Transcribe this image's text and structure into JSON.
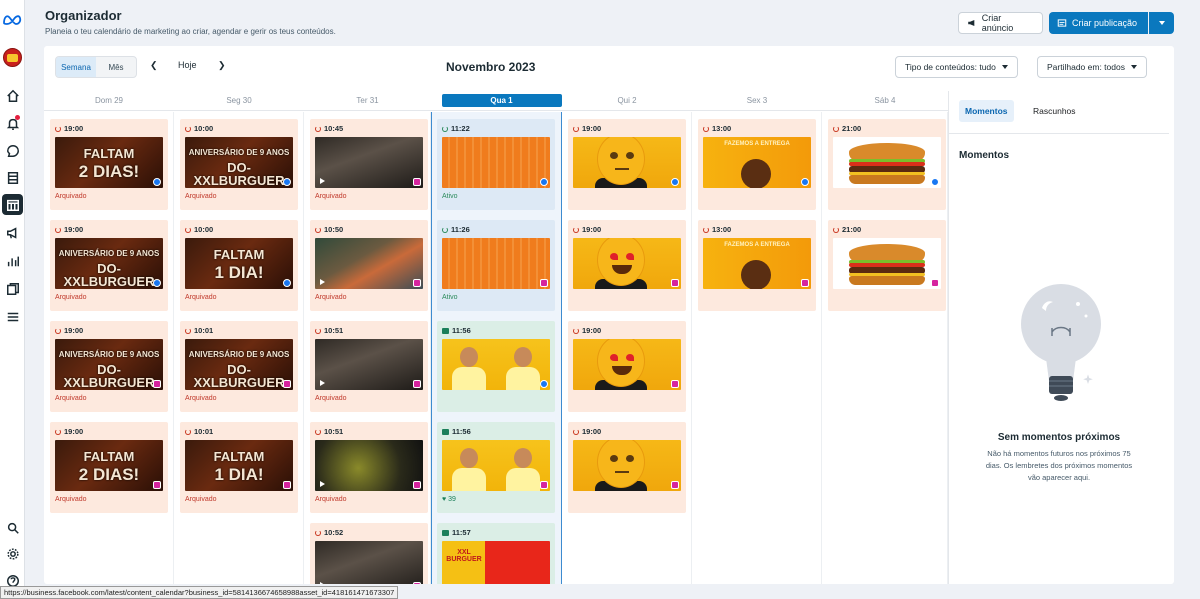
{
  "app": {
    "title": "Organizador",
    "subtitle": "Planeia o teu calendário de marketing ao criar, agendar e gerir os teus conteúdos."
  },
  "header": {
    "create_ad": "Criar anúncio",
    "create_post": "Criar publicação"
  },
  "toolbar": {
    "view_week": "Semana",
    "view_month": "Mês",
    "today": "Hoje",
    "month_label": "Novembro 2023",
    "filter_content": "Tipo de conteúdos: tudo",
    "filter_shared": "Partilhado em: todos"
  },
  "days": [
    "Dom 29",
    "Seg 30",
    "Ter 31",
    "Qua 1",
    "Qui 2",
    "Sex 3",
    "Sáb 4"
  ],
  "columns": [
    [
      {
        "time": "19:00",
        "status": "Arquivado",
        "platform": "facebook",
        "theme": "faltam",
        "line1": "FALTAM",
        "line2": "2 DIAS!"
      },
      {
        "time": "19:00",
        "status": "Arquivado",
        "platform": "facebook",
        "theme": "anniv",
        "line1": "ANIVERSÁRIO DE 9 ANOS",
        "line2": "DO-XXLBURGUER"
      },
      {
        "time": "19:00",
        "status": "Arquivado",
        "platform": "instagram",
        "theme": "anniv",
        "line1": "ANIVERSÁRIO DE 9 ANOS",
        "line2": "DO-XXLBURGUER"
      },
      {
        "time": "19:00",
        "status": "Arquivado",
        "platform": "instagram",
        "theme": "faltam",
        "line1": "FALTAM",
        "line2": "2 DIAS!"
      }
    ],
    [
      {
        "time": "10:00",
        "status": "Arquivado",
        "platform": "facebook",
        "theme": "anniv",
        "line1": "ANIVERSÁRIO DE 9 ANOS",
        "line2": "DO-XXLBURGUER"
      },
      {
        "time": "10:00",
        "status": "Arquivado",
        "platform": "facebook",
        "theme": "faltam",
        "line1": "FALTAM",
        "line2": "1 DIA!"
      },
      {
        "time": "10:01",
        "status": "Arquivado",
        "platform": "instagram",
        "theme": "anniv",
        "line1": "ANIVERSÁRIO DE 9 ANOS",
        "line2": "DO-XXLBURGUER"
      },
      {
        "time": "10:01",
        "status": "Arquivado",
        "platform": "instagram",
        "theme": "faltam",
        "line1": "FALTAM",
        "line2": "1 DIA!"
      }
    ],
    [
      {
        "time": "10:45",
        "status": "Arquivado",
        "platform": "instagram",
        "theme": "video"
      },
      {
        "time": "10:50",
        "status": "Arquivado",
        "platform": "instagram",
        "theme": "video2"
      },
      {
        "time": "10:51",
        "status": "Arquivado",
        "platform": "instagram",
        "theme": "video"
      },
      {
        "time": "10:51",
        "status": "Arquivado",
        "platform": "instagram",
        "theme": "video3"
      },
      {
        "time": "10:52",
        "status": "",
        "platform": "instagram",
        "theme": "video"
      }
    ],
    [
      {
        "time": "11:22",
        "status": "Ativo",
        "platform": "facebook",
        "theme": "orange",
        "kind": "blue"
      },
      {
        "time": "11:26",
        "status": "Ativo",
        "platform": "instagram",
        "theme": "orange",
        "kind": "blue"
      },
      {
        "time": "11:56",
        "status": "",
        "platform": "facebook",
        "theme": "people",
        "kind": "green"
      },
      {
        "time": "11:56",
        "status": "",
        "platform": "instagram",
        "theme": "people",
        "kind": "green",
        "likes": "39"
      },
      {
        "time": "11:57",
        "status": "",
        "platform": "",
        "theme": "xxl",
        "kind": "green"
      }
    ],
    [
      {
        "time": "19:00",
        "status": "",
        "platform": "facebook",
        "theme": "emoji-meh"
      },
      {
        "time": "19:00",
        "status": "",
        "platform": "instagram",
        "theme": "emoji-love"
      },
      {
        "time": "19:00",
        "status": "",
        "platform": "instagram",
        "theme": "emoji-love"
      },
      {
        "time": "19:00",
        "status": "",
        "platform": "instagram",
        "theme": "emoji-meh"
      }
    ],
    [
      {
        "time": "13:00",
        "status": "",
        "platform": "facebook",
        "theme": "delivery"
      },
      {
        "time": "13:00",
        "status": "",
        "platform": "instagram",
        "theme": "delivery"
      }
    ],
    [
      {
        "time": "21:00",
        "status": "",
        "platform": "facebook",
        "theme": "burger"
      },
      {
        "time": "21:00",
        "status": "",
        "platform": "instagram",
        "theme": "burger"
      }
    ]
  ],
  "right": {
    "tab_moments": "Momentos",
    "tab_drafts": "Rascunhos",
    "heading": "Momentos",
    "empty_title": "Sem momentos próximos",
    "empty_text": "Não há momentos futuros nos próximos 75 dias. Os lembretes dos próximos momentos vão aparecer aqui."
  },
  "status_url": "https://business.facebook.com/latest/content_calendar?business_id=5814136674658988asset_id=418161471673307",
  "delivery_text": "FAZEMOS A ENTREGA",
  "brand_text": "XXL BURGUER"
}
